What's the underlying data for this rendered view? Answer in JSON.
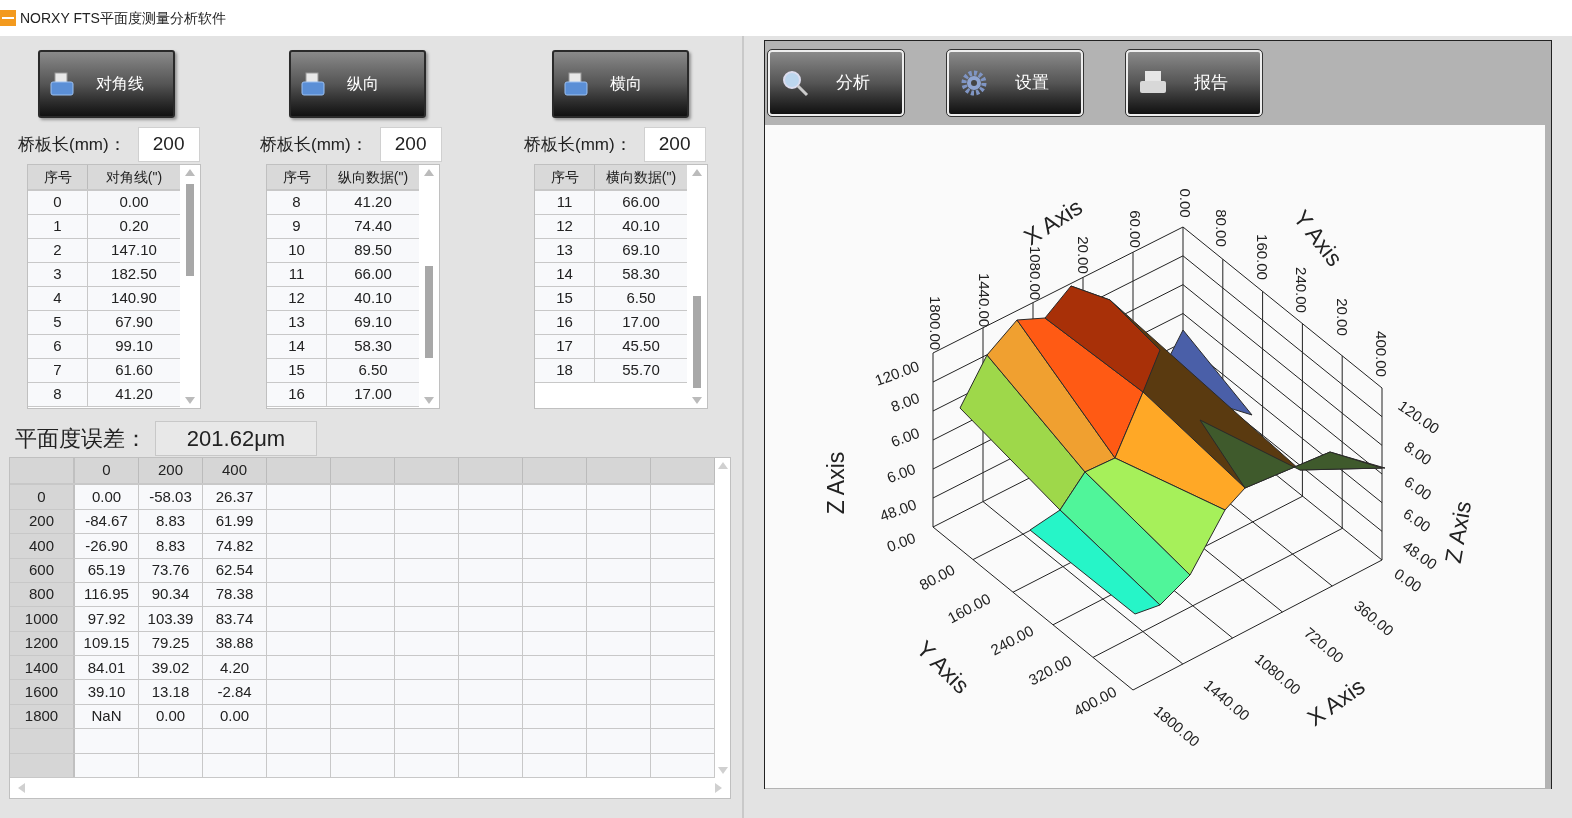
{
  "window": {
    "title": "NORXY FTS平面度测量分析软件"
  },
  "panels": [
    {
      "button": "对角线",
      "length_label": "桥板长(mm)：",
      "length_value": "200",
      "columns": [
        "序号",
        "对角线(\")"
      ],
      "rows": [
        [
          "0",
          "0.00"
        ],
        [
          "1",
          "0.20"
        ],
        [
          "2",
          "147.10"
        ],
        [
          "3",
          "182.50"
        ],
        [
          "4",
          "140.90"
        ],
        [
          "5",
          "67.90"
        ],
        [
          "6",
          "99.10"
        ],
        [
          "7",
          "61.60"
        ],
        [
          "8",
          "41.20"
        ]
      ]
    },
    {
      "button": "纵向",
      "length_label": "桥板长(mm)：",
      "length_value": "200",
      "columns": [
        "序号",
        "纵向数据(\")"
      ],
      "rows": [
        [
          "8",
          "41.20"
        ],
        [
          "9",
          "74.40"
        ],
        [
          "10",
          "89.50"
        ],
        [
          "11",
          "66.00"
        ],
        [
          "12",
          "40.10"
        ],
        [
          "13",
          "69.10"
        ],
        [
          "14",
          "58.30"
        ],
        [
          "15",
          "6.50"
        ],
        [
          "16",
          "17.00"
        ]
      ]
    },
    {
      "button": "横向",
      "length_label": "桥板长(mm)：",
      "length_value": "200",
      "columns": [
        "序号",
        "横向数据(\")"
      ],
      "rows": [
        [
          "11",
          "66.00"
        ],
        [
          "12",
          "40.10"
        ],
        [
          "13",
          "69.10"
        ],
        [
          "14",
          "58.30"
        ],
        [
          "15",
          "6.50"
        ],
        [
          "16",
          "17.00"
        ],
        [
          "17",
          "45.50"
        ],
        [
          "18",
          "55.70"
        ]
      ]
    }
  ],
  "flatness": {
    "label": "平面度误差：",
    "value": "201.62μm"
  },
  "grid": {
    "columns": [
      "0",
      "200",
      "400"
    ],
    "rows": [
      {
        "label": "0",
        "cells": [
          "0.00",
          "-58.03",
          "26.37"
        ]
      },
      {
        "label": "200",
        "cells": [
          "-84.67",
          "8.83",
          "61.99"
        ]
      },
      {
        "label": "400",
        "cells": [
          "-26.90",
          "8.83",
          "74.82"
        ]
      },
      {
        "label": "600",
        "cells": [
          "65.19",
          "73.76",
          "62.54"
        ]
      },
      {
        "label": "800",
        "cells": [
          "116.95",
          "90.34",
          "78.38"
        ]
      },
      {
        "label": "1000",
        "cells": [
          "97.92",
          "103.39",
          "83.74"
        ]
      },
      {
        "label": "1200",
        "cells": [
          "109.15",
          "79.25",
          "38.88"
        ]
      },
      {
        "label": "1400",
        "cells": [
          "84.01",
          "39.02",
          "4.20"
        ]
      },
      {
        "label": "1600",
        "cells": [
          "39.10",
          "13.18",
          "-2.84"
        ]
      },
      {
        "label": "1800",
        "cells": [
          "NaN",
          "0.00",
          "0.00"
        ]
      }
    ]
  },
  "toolbar": [
    {
      "label": "分析",
      "kind": "search"
    },
    {
      "label": "设置",
      "kind": "gear"
    },
    {
      "label": "报告",
      "kind": "printer"
    }
  ],
  "plot": {
    "labels": [
      {
        "kind": "tick",
        "text": "1800.00"
      },
      {
        "kind": "tick",
        "text": "1440.00"
      },
      {
        "kind": "tick",
        "text": "1080.00"
      },
      {
        "kind": "tick",
        "text": "20.00"
      },
      {
        "kind": "tick",
        "text": "60.00"
      },
      {
        "kind": "tick",
        "text": "0.00"
      },
      {
        "kind": "tick",
        "text": "80.00"
      },
      {
        "kind": "tick",
        "text": "160.00"
      },
      {
        "kind": "tick",
        "text": "240.00"
      },
      {
        "kind": "tick",
        "text": "20.00"
      },
      {
        "kind": "tick",
        "text": "400.00"
      },
      {
        "kind": "title",
        "text": "X Axis"
      },
      {
        "kind": "title",
        "text": "Y Axis"
      },
      {
        "kind": "tick",
        "text": "120.00"
      },
      {
        "kind": "tick",
        "text": "8.00"
      },
      {
        "kind": "tick",
        "text": "6.00"
      },
      {
        "kind": "tick",
        "text": "6.00"
      },
      {
        "kind": "tick",
        "text": "48.00"
      },
      {
        "kind": "tick",
        "text": "0.00"
      },
      {
        "kind": "title",
        "text": "Z Axis"
      },
      {
        "kind": "tick",
        "text": "120.00"
      },
      {
        "kind": "tick",
        "text": "8.00"
      },
      {
        "kind": "tick",
        "text": "6.00"
      },
      {
        "kind": "tick",
        "text": "6.00"
      },
      {
        "kind": "tick",
        "text": "48.00"
      },
      {
        "kind": "tick",
        "text": "0.00"
      },
      {
        "kind": "title",
        "text": "Z Axis"
      },
      {
        "kind": "tick",
        "text": "80.00"
      },
      {
        "kind": "tick",
        "text": "160.00"
      },
      {
        "kind": "tick",
        "text": "240.00"
      },
      {
        "kind": "tick",
        "text": "320.00"
      },
      {
        "kind": "tick",
        "text": "400.00"
      },
      {
        "kind": "title",
        "text": "Y Axis"
      },
      {
        "kind": "tick",
        "text": "1800.00"
      },
      {
        "kind": "tick",
        "text": "1440.00"
      },
      {
        "kind": "tick",
        "text": "1080.00"
      },
      {
        "kind": "tick",
        "text": "720.00"
      },
      {
        "kind": "tick",
        "text": "360.00"
      },
      {
        "kind": "title",
        "text": "X Axis"
      }
    ]
  }
}
